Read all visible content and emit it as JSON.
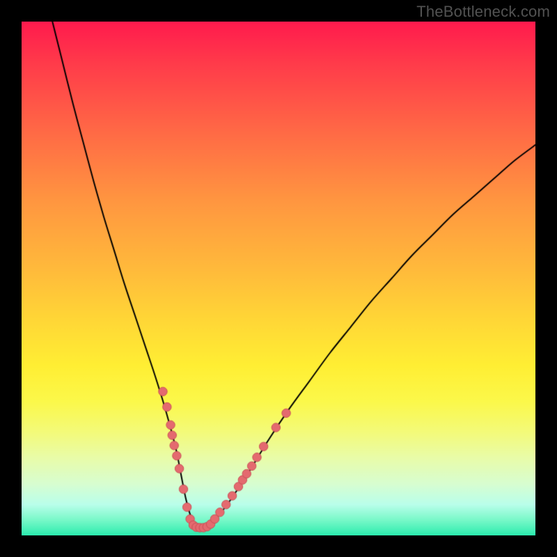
{
  "watermark": {
    "text": "TheBottleneck.com"
  },
  "colors": {
    "curve_stroke": "#000000",
    "dot_fill": "#e46a6f",
    "dot_stroke": "#c94f55"
  },
  "chart_data": {
    "type": "line",
    "title": "",
    "xlabel": "",
    "ylabel": "",
    "xlim": [
      0,
      100
    ],
    "ylim": [
      0,
      100
    ],
    "series": [
      {
        "name": "bottleneck-curve",
        "x": [
          6,
          8,
          10,
          12,
          14,
          16,
          18,
          20,
          22,
          24,
          26,
          28,
          30,
          31,
          32,
          33,
          34,
          35,
          37,
          40,
          44,
          48,
          52,
          56,
          60,
          64,
          68,
          72,
          76,
          80,
          84,
          88,
          92,
          96,
          100
        ],
        "y": [
          100,
          92,
          84,
          76.5,
          69,
          62,
          55.5,
          49,
          43,
          37,
          31,
          24.5,
          17,
          12,
          7,
          3.5,
          1.5,
          1.5,
          2.5,
          6,
          12,
          18.5,
          24.5,
          30,
          35.5,
          40.5,
          45.5,
          50,
          54.5,
          58.5,
          62.5,
          66,
          69.5,
          73,
          76
        ]
      }
    ],
    "dots": [
      {
        "x": 27.5,
        "y": 28.0
      },
      {
        "x": 28.3,
        "y": 25.0
      },
      {
        "x": 29.0,
        "y": 21.5
      },
      {
        "x": 29.3,
        "y": 19.5
      },
      {
        "x": 29.7,
        "y": 17.5
      },
      {
        "x": 30.2,
        "y": 15.5
      },
      {
        "x": 30.7,
        "y": 13.0
      },
      {
        "x": 31.5,
        "y": 9.0
      },
      {
        "x": 32.2,
        "y": 5.5
      },
      {
        "x": 32.8,
        "y": 3.2
      },
      {
        "x": 33.4,
        "y": 2.0
      },
      {
        "x": 34.0,
        "y": 1.6
      },
      {
        "x": 34.7,
        "y": 1.5
      },
      {
        "x": 35.4,
        "y": 1.5
      },
      {
        "x": 36.1,
        "y": 1.7
      },
      {
        "x": 36.8,
        "y": 2.2
      },
      {
        "x": 37.6,
        "y": 3.2
      },
      {
        "x": 38.6,
        "y": 4.5
      },
      {
        "x": 39.8,
        "y": 6.0
      },
      {
        "x": 41.0,
        "y": 7.7
      },
      {
        "x": 42.2,
        "y": 9.5
      },
      {
        "x": 43.0,
        "y": 10.8
      },
      {
        "x": 43.8,
        "y": 12.0
      },
      {
        "x": 44.8,
        "y": 13.5
      },
      {
        "x": 45.8,
        "y": 15.2
      },
      {
        "x": 47.1,
        "y": 17.3
      },
      {
        "x": 49.5,
        "y": 21.0
      },
      {
        "x": 51.5,
        "y": 23.8
      }
    ]
  }
}
